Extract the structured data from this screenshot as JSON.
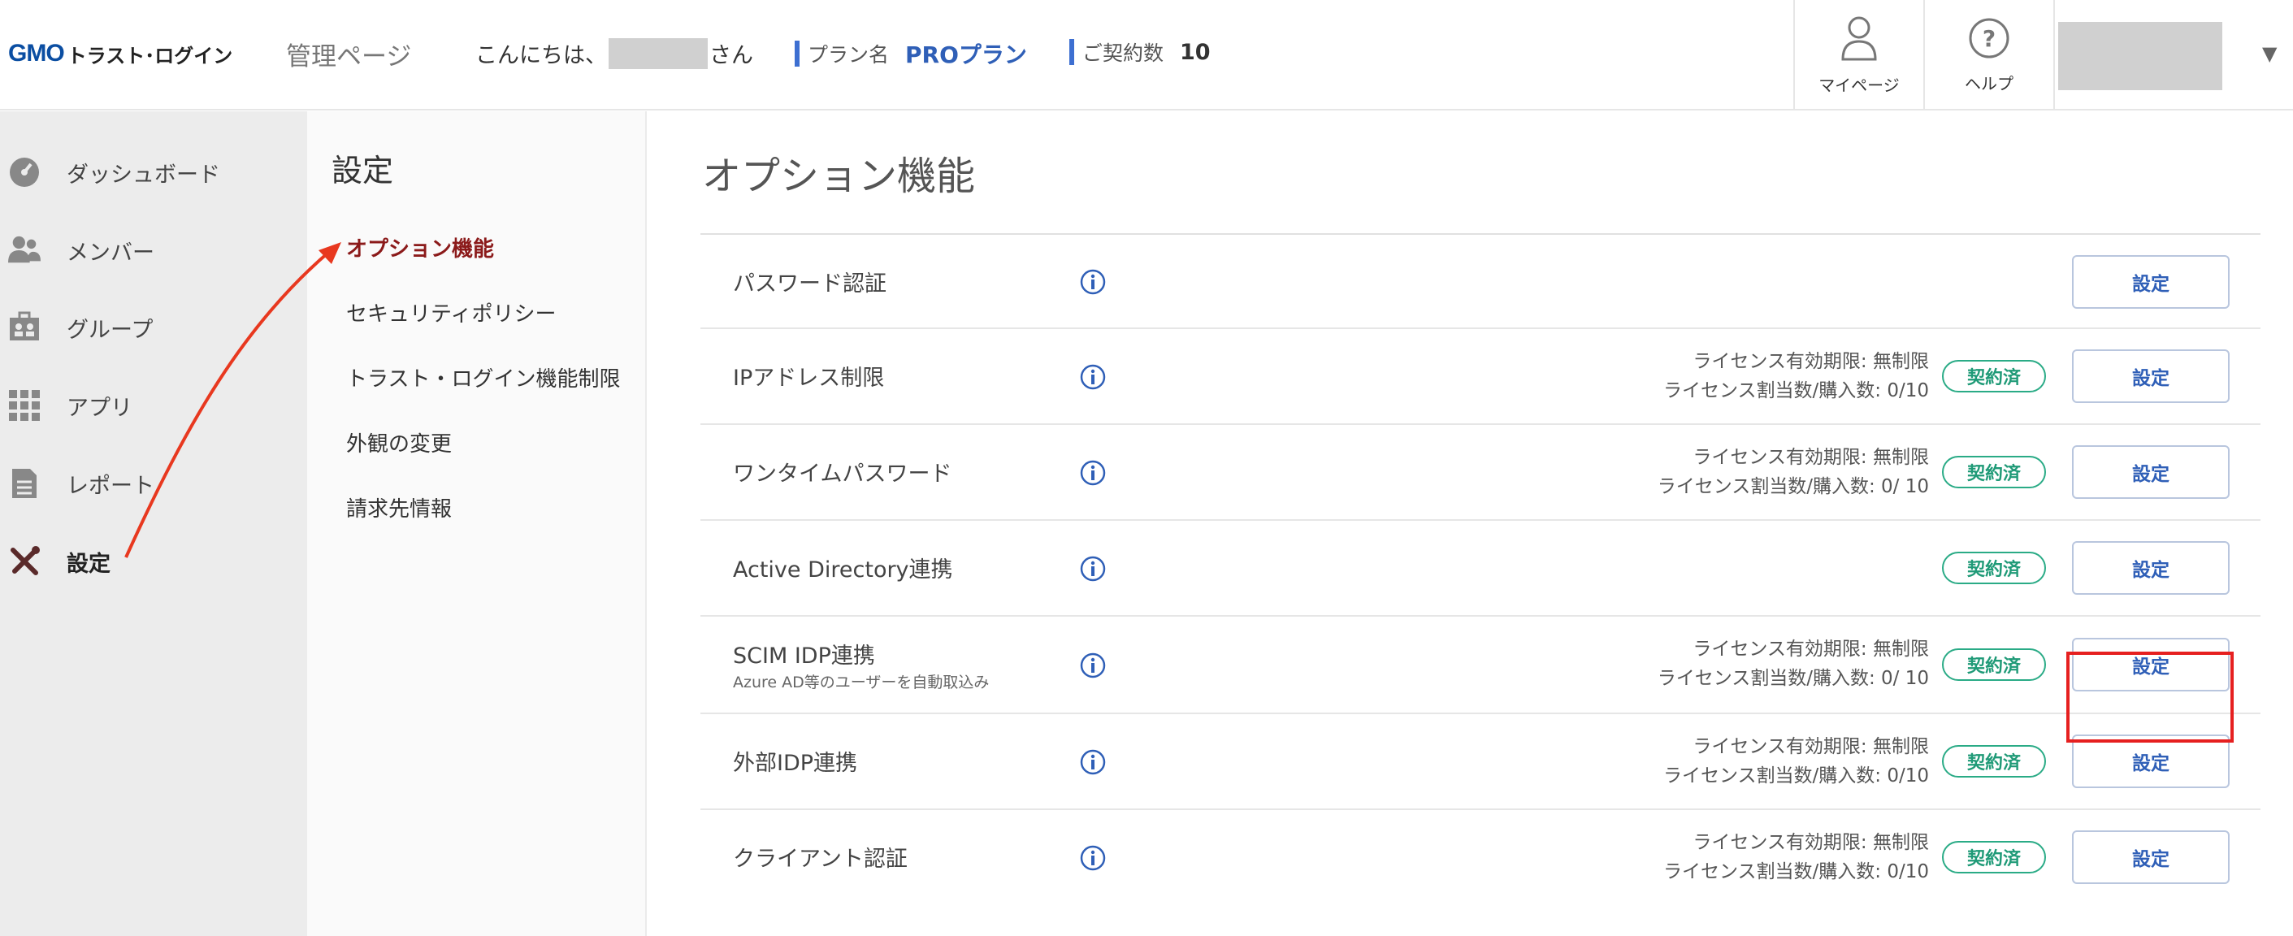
{
  "header": {
    "logo_gmo": "GMO",
    "logo_brand": "トラスト･ログイン",
    "admin_title": "管理ページ",
    "greeting_prefix": "こんにちは、",
    "greeting_suffix": "さん",
    "plan_label": "プラン名",
    "plan_value": "PROプラン",
    "contract_label": "ご契約数",
    "contract_value": "10",
    "mypage_label": "マイページ",
    "help_label": "ヘルプ"
  },
  "sidebar": {
    "items": [
      {
        "label": "ダッシュボード",
        "icon": "dashboard-icon"
      },
      {
        "label": "メンバー",
        "icon": "members-icon"
      },
      {
        "label": "グループ",
        "icon": "group-icon"
      },
      {
        "label": "アプリ",
        "icon": "apps-icon"
      },
      {
        "label": "レポート",
        "icon": "report-icon"
      },
      {
        "label": "設定",
        "icon": "settings-tools-icon"
      }
    ]
  },
  "subnav": {
    "title": "設定",
    "items": [
      {
        "label": "オプション機能"
      },
      {
        "label": "セキュリティポリシー"
      },
      {
        "label": "トラスト・ログイン機能制限"
      },
      {
        "label": "外観の変更"
      },
      {
        "label": "請求先情報"
      }
    ]
  },
  "main": {
    "title": "オプション機能",
    "button_label": "設定",
    "badge_label": "契約済",
    "rows": [
      {
        "name": "パスワード認証",
        "sub": "",
        "lic1": "",
        "lic2": ""
      },
      {
        "name": "IPアドレス制限",
        "sub": "",
        "lic1": "ライセンス有効期限: 無制限",
        "lic2": "ライセンス割当数/購入数: 0/10"
      },
      {
        "name": "ワンタイムパスワード",
        "sub": "",
        "lic1": "ライセンス有効期限: 無制限",
        "lic2": "ライセンス割当数/購入数: 0/ 10"
      },
      {
        "name": "Active Directory連携",
        "sub": "",
        "lic1": "",
        "lic2": ""
      },
      {
        "name": "SCIM IDP連携",
        "sub": "Azure AD等のユーザーを自動取込み",
        "lic1": "ライセンス有効期限: 無制限",
        "lic2": "ライセンス割当数/購入数: 0/ 10"
      },
      {
        "name": "外部IDP連携",
        "sub": "",
        "lic1": "ライセンス有効期限: 無制限",
        "lic2": "ライセンス割当数/購入数: 0/10"
      },
      {
        "name": "クライアント認証",
        "sub": "",
        "lic1": "ライセンス有効期限: 無制限",
        "lic2": "ライセンス割当数/購入数: 0/10"
      }
    ]
  }
}
